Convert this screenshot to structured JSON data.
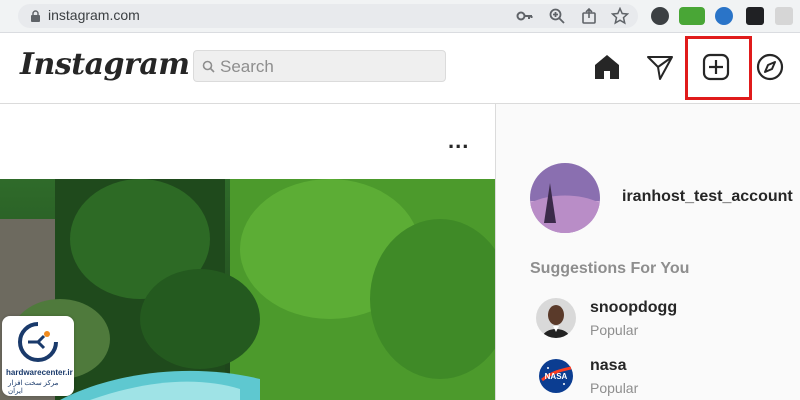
{
  "browser": {
    "url": "instagram.com",
    "extension_icons": [
      "key-icon",
      "zoom-icon",
      "share-icon",
      "star-icon",
      "profile-circle-icon",
      "extension-green-icon",
      "extension-globe-icon",
      "extension-dark-icon",
      "extension-bracket-icon"
    ]
  },
  "header": {
    "logo": "Instagram",
    "search_placeholder": "Search",
    "nav_icons": [
      "home-icon",
      "send-icon",
      "new-post-icon",
      "explore-icon"
    ]
  },
  "post": {
    "more_label": "..."
  },
  "sidebar": {
    "account_username": "iranhost_test_account",
    "suggestions_title": "Suggestions For You",
    "suggestions": [
      {
        "username": "snoopdogg",
        "subtitle": "Popular"
      },
      {
        "username": "nasa",
        "subtitle": "Popular"
      }
    ]
  },
  "watermark": {
    "domain": "hardwarecenter.ir",
    "tagline": "مرکز سخت افزار ایران"
  },
  "colors": {
    "highlight": "#e01b1b",
    "text": "#262626",
    "muted": "#8e8e8e"
  }
}
